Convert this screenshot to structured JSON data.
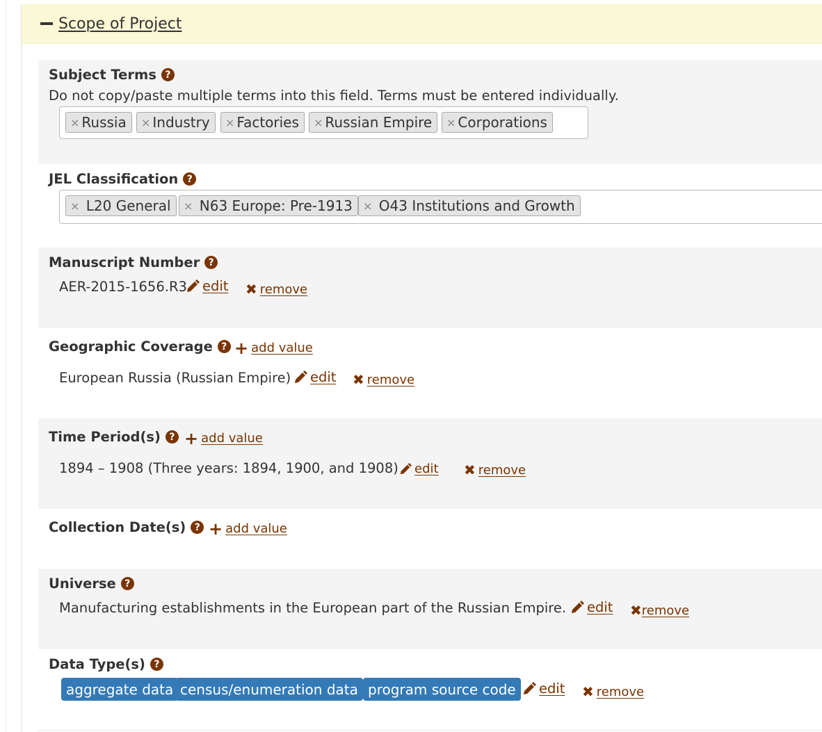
{
  "panel": {
    "title": "Scope of Project"
  },
  "subject_terms": {
    "label": "Subject Terms",
    "note": "Do not copy/paste multiple terms into this field. Terms must be entered individually.",
    "tags": [
      "Russia",
      "Industry",
      "Factories",
      "Russian Empire",
      "Corporations"
    ]
  },
  "jel": {
    "label": "JEL Classification",
    "tags": [
      "L20 General",
      "N63 Europe: Pre-1913",
      "O43 Institutions and Growth"
    ]
  },
  "manuscript": {
    "label": "Manuscript Number",
    "value": "AER-2015-1656.R3",
    "edit": "edit",
    "remove": "remove"
  },
  "geographic": {
    "label": "Geographic Coverage",
    "add": "add value",
    "value": "European Russia (Russian Empire)",
    "edit": "edit",
    "remove": "remove"
  },
  "time_period": {
    "label": "Time Period(s)",
    "add": "add value",
    "value": "1894 – 1908 (Three years: 1894, 1900, and 1908)",
    "edit": "edit",
    "remove": "remove"
  },
  "collection": {
    "label": "Collection Date(s)",
    "add": "add value"
  },
  "universe": {
    "label": "Universe",
    "value": "Manufacturing establishments in the European part of the Russian Empire.",
    "edit": "edit",
    "remove": "remove"
  },
  "data_types": {
    "label": "Data Type(s)",
    "badges": [
      "aggregate data",
      "census/enumeration data",
      "program source code"
    ],
    "edit": "edit",
    "remove": "remove"
  },
  "icons": {
    "help": "question-circle-icon",
    "edit": "pencil-icon",
    "remove": "times-icon",
    "add": "plus-icon",
    "tag_remove": "x-icon"
  },
  "colors": {
    "accent": "#7a3400",
    "badge": "#337ab7",
    "header_bg": "#fbf8d6",
    "shaded_bg": "#f4f4f4"
  }
}
